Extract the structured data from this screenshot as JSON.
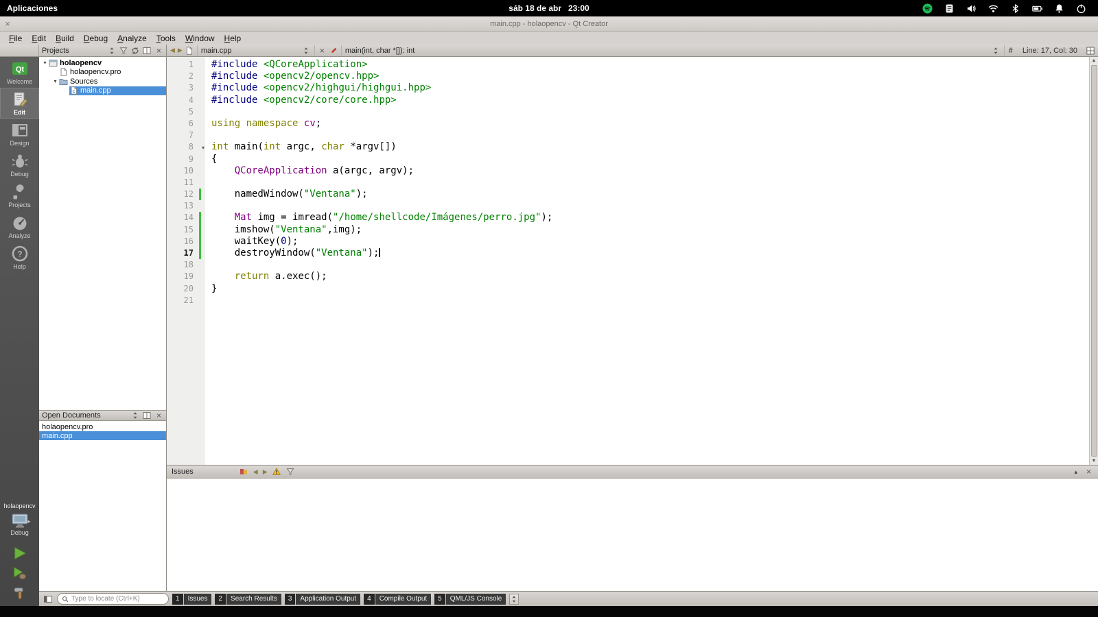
{
  "colors": {
    "selection_blue": "#4a90d9",
    "change_bar_green": "#3fbf3f",
    "warning_yellow": "#f0c233",
    "spotify_green": "#1db954",
    "run_green": "#6cb33e",
    "keyword_olive": "#808000",
    "type_purple": "#800080",
    "string_green": "#008000",
    "preprocessor_navy": "#000080"
  },
  "icons": {
    "tray": [
      "spotify-icon",
      "tray-indicator-icon",
      "volume-icon",
      "wifi-icon",
      "bluetooth-icon",
      "battery-icon",
      "notifications-icon",
      "power-icon"
    ],
    "toolbar": [
      "combo-arrows-icon",
      "filter-icon",
      "sync-icon",
      "split-icon",
      "close-icon",
      "back-icon",
      "forward-icon",
      "document-icon",
      "pencil-icon",
      "hash-icon",
      "split-editor-icon"
    ],
    "issues": [
      "filter-category-icon",
      "previous-issue-icon",
      "next-issue-icon",
      "warning-icon",
      "funnel-icon",
      "minimize-icon",
      "close-icon"
    ],
    "status": [
      "toggle-sidebar-icon",
      "search-icon",
      "pane-spinner-icon"
    ]
  },
  "system_bar": {
    "applications_label": "Aplicaciones",
    "date": "sáb 18 de abr",
    "time": "23:00",
    "tray_icons": [
      "spotify-icon",
      "tray-indicator-icon",
      "volume-icon",
      "wifi-icon",
      "bluetooth-icon",
      "battery-icon",
      "notifications-icon",
      "power-icon"
    ]
  },
  "title_bar": {
    "title": "main.cpp - holaopencv - Qt Creator",
    "close_glyph": "×"
  },
  "menu_bar": {
    "items": [
      "File",
      "Edit",
      "Build",
      "Debug",
      "Analyze",
      "Tools",
      "Window",
      "Help"
    ]
  },
  "nav_panel": {
    "header": {
      "title": "Projects"
    },
    "tree": [
      {
        "label": "holaopencv",
        "depth": 0,
        "icon": "project",
        "expander": true,
        "bold": true
      },
      {
        "label": "holaopencv.pro",
        "depth": 1,
        "icon": "file"
      },
      {
        "label": "Sources",
        "depth": 1,
        "icon": "folder",
        "expander": true
      },
      {
        "label": "main.cpp",
        "depth": 2,
        "icon": "cpp",
        "selected": true
      }
    ]
  },
  "open_documents": {
    "header": {
      "title": "Open Documents"
    },
    "items": [
      {
        "label": "holaopencv.pro"
      },
      {
        "label": "main.cpp",
        "selected": true
      }
    ]
  },
  "mode_sidebar": {
    "modes": [
      {
        "label": "Welcome",
        "icon": "welcome"
      },
      {
        "label": "Edit",
        "icon": "edit",
        "active": true
      },
      {
        "label": "Design",
        "icon": "design"
      },
      {
        "label": "Debug",
        "icon": "debug"
      },
      {
        "label": "Projects",
        "icon": "projects"
      },
      {
        "label": "Analyze",
        "icon": "analyze"
      },
      {
        "label": "Help",
        "icon": "help"
      }
    ],
    "project_name": "holaopencv",
    "target_label": "Debug"
  },
  "editor": {
    "toolbar": {
      "file_combo": "main.cpp",
      "symbol_combo": "main(int, char *[]): int",
      "line_col": "Line: 17, Col: 30"
    },
    "lines": [
      {
        "n": "1",
        "seg": [
          [
            "pp",
            "#include"
          ],
          [
            "p",
            " "
          ],
          [
            "inc",
            "<QCoreApplication>"
          ]
        ]
      },
      {
        "n": "2",
        "seg": [
          [
            "pp",
            "#include"
          ],
          [
            "p",
            " "
          ],
          [
            "inc",
            "<opencv2/opencv.hpp>"
          ]
        ]
      },
      {
        "n": "3",
        "seg": [
          [
            "pp",
            "#include"
          ],
          [
            "p",
            " "
          ],
          [
            "inc",
            "<opencv2/highgui/highgui.hpp>"
          ]
        ]
      },
      {
        "n": "4",
        "seg": [
          [
            "pp",
            "#include"
          ],
          [
            "p",
            " "
          ],
          [
            "inc",
            "<opencv2/core/core.hpp>"
          ]
        ]
      },
      {
        "n": "5",
        "seg": []
      },
      {
        "n": "6",
        "seg": [
          [
            "kw",
            "using"
          ],
          [
            "p",
            " "
          ],
          [
            "kw",
            "namespace"
          ],
          [
            "p",
            " "
          ],
          [
            "ty",
            "cv"
          ],
          [
            "p",
            ";"
          ]
        ]
      },
      {
        "n": "7",
        "seg": []
      },
      {
        "n": "8",
        "fold": true,
        "seg": [
          [
            "kw",
            "int"
          ],
          [
            "p",
            " main("
          ],
          [
            "kw",
            "int"
          ],
          [
            "p",
            " argc, "
          ],
          [
            "kw",
            "char"
          ],
          [
            "p",
            " *argv[])"
          ]
        ]
      },
      {
        "n": "9",
        "seg": [
          [
            "p",
            "{"
          ]
        ]
      },
      {
        "n": "10",
        "seg": [
          [
            "p",
            "    "
          ],
          [
            "ty",
            "QCoreApplication"
          ],
          [
            "p",
            " a(argc, argv);"
          ]
        ]
      },
      {
        "n": "11",
        "seg": []
      },
      {
        "n": "12",
        "changed": true,
        "seg": [
          [
            "p",
            "    namedWindow("
          ],
          [
            "st",
            "\"Ventana\""
          ],
          [
            "p",
            ");"
          ]
        ]
      },
      {
        "n": "13",
        "seg": []
      },
      {
        "n": "14",
        "changed": true,
        "seg": [
          [
            "p",
            "    "
          ],
          [
            "ty",
            "Mat"
          ],
          [
            "p",
            " img = imread("
          ],
          [
            "st",
            "\"/home/shellcode/Imágenes/perro.jpg\""
          ],
          [
            "p",
            ");"
          ]
        ]
      },
      {
        "n": "15",
        "changed": true,
        "seg": [
          [
            "p",
            "    imshow("
          ],
          [
            "st",
            "\"Ventana\""
          ],
          [
            "p",
            ",img);"
          ]
        ]
      },
      {
        "n": "16",
        "changed": true,
        "seg": [
          [
            "p",
            "    waitKey("
          ],
          [
            "nu",
            "0"
          ],
          [
            "p",
            ");"
          ]
        ]
      },
      {
        "n": "17",
        "changed": true,
        "current": true,
        "caret": true,
        "seg": [
          [
            "p",
            "    destroyWindow("
          ],
          [
            "st",
            "\"Ventana\""
          ],
          [
            "p",
            ");"
          ]
        ]
      },
      {
        "n": "18",
        "seg": []
      },
      {
        "n": "19",
        "seg": [
          [
            "p",
            "    "
          ],
          [
            "kw",
            "return"
          ],
          [
            "p",
            " a.exec();"
          ]
        ]
      },
      {
        "n": "20",
        "seg": [
          [
            "p",
            "}"
          ]
        ]
      },
      {
        "n": "21",
        "seg": []
      }
    ]
  },
  "issues_panel": {
    "title": "Issues"
  },
  "status_bar": {
    "locator_placeholder": "Type to locate (Ctrl+K)",
    "panes": [
      {
        "num": "1",
        "label": "Issues"
      },
      {
        "num": "2",
        "label": "Search Results"
      },
      {
        "num": "3",
        "label": "Application Output"
      },
      {
        "num": "4",
        "label": "Compile Output"
      },
      {
        "num": "5",
        "label": "QML/JS Console"
      }
    ]
  }
}
